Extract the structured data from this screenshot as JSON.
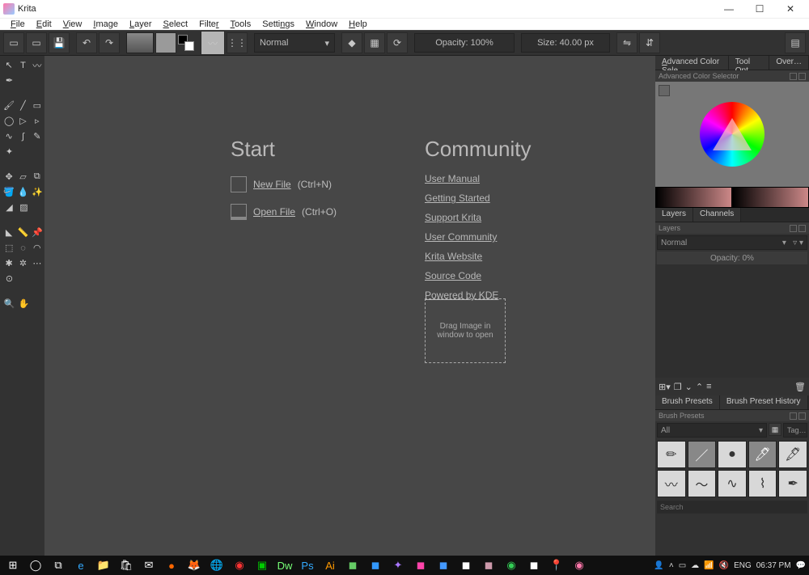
{
  "title": "Krita",
  "menu": [
    "File",
    "Edit",
    "View",
    "Image",
    "Layer",
    "Select",
    "Filter",
    "Tools",
    "Settings",
    "Window",
    "Help"
  ],
  "toolbar": {
    "blend_mode": "Normal",
    "opacity_label": "Opacity:",
    "opacity_value": "100%",
    "size_label": "Size:",
    "size_value": "40.00 px"
  },
  "start": {
    "heading": "Start",
    "new_file": "New File",
    "new_shortcut": "(Ctrl+N)",
    "open_file": "Open File",
    "open_shortcut": "(Ctrl+O)"
  },
  "community": {
    "heading": "Community",
    "links": [
      "User Manual",
      "Getting Started",
      "Support Krita",
      "User Community",
      "Krita Website",
      "Source Code",
      "Powered by KDE"
    ]
  },
  "dropzone": "Drag Image in window to open",
  "right": {
    "tabs_top": [
      "Advanced Color Sele…",
      "Tool Opt…",
      "Over…"
    ],
    "adv_color_label": "Advanced Color Selector",
    "tabs_layers": [
      "Layers",
      "Channels"
    ],
    "layers_label": "Layers",
    "layers_mode": "Normal",
    "layers_opacity": "Opacity:  0%",
    "tabs_brush": [
      "Brush Presets",
      "Brush Preset History"
    ],
    "brush_label": "Brush Presets",
    "brush_filter": "All",
    "brush_tag": "Tag…",
    "search_placeholder": "Search"
  },
  "systray": {
    "lang": "ENG",
    "time": "06:37 PM"
  }
}
